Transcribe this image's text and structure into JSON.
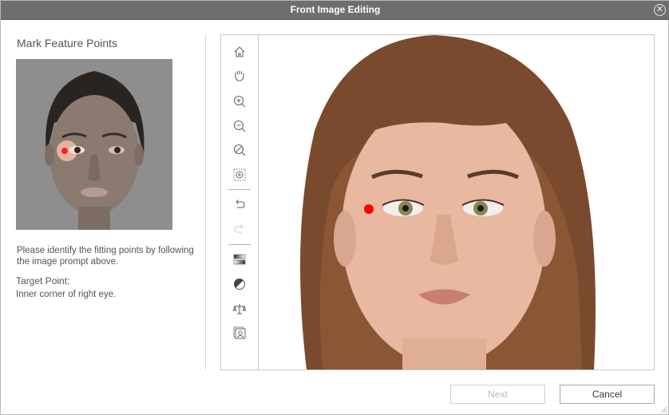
{
  "window": {
    "title": "Front Image Editing",
    "close_icon": "close-circle-icon"
  },
  "left_panel": {
    "heading": "Mark Feature Points",
    "instruction": "Please identify the fitting points by following the image prompt above.",
    "target_label": "Target Point:",
    "target_value": "Inner corner of right eye."
  },
  "toolbar": {
    "tools": [
      {
        "name": "home",
        "icon": "home-icon",
        "enabled": true
      },
      {
        "name": "pan",
        "icon": "hand-icon",
        "enabled": true
      },
      {
        "name": "zoom-in",
        "icon": "zoom-in-icon",
        "enabled": true
      },
      {
        "name": "zoom-out",
        "icon": "zoom-out-icon",
        "enabled": true
      },
      {
        "name": "zoom-reset",
        "icon": "zoom-reset-icon",
        "enabled": true
      },
      {
        "name": "zoom-fit",
        "icon": "zoom-region-icon",
        "enabled": true
      },
      {
        "name": "undo",
        "icon": "undo-icon",
        "enabled": true
      },
      {
        "name": "redo",
        "icon": "redo-icon",
        "enabled": false
      },
      {
        "name": "gradient",
        "icon": "gradient-icon",
        "enabled": true
      },
      {
        "name": "contrast",
        "icon": "contrast-icon",
        "enabled": true
      },
      {
        "name": "balance",
        "icon": "balance-icon",
        "enabled": true
      },
      {
        "name": "portrait",
        "icon": "portrait-icon",
        "enabled": true
      }
    ]
  },
  "colors": {
    "marker": "#ff0000",
    "titlebar": "#6e6e6e",
    "scrollbar": "#b5b5b5"
  },
  "buttons": {
    "next": "Next",
    "cancel": "Cancel",
    "next_enabled": false
  }
}
